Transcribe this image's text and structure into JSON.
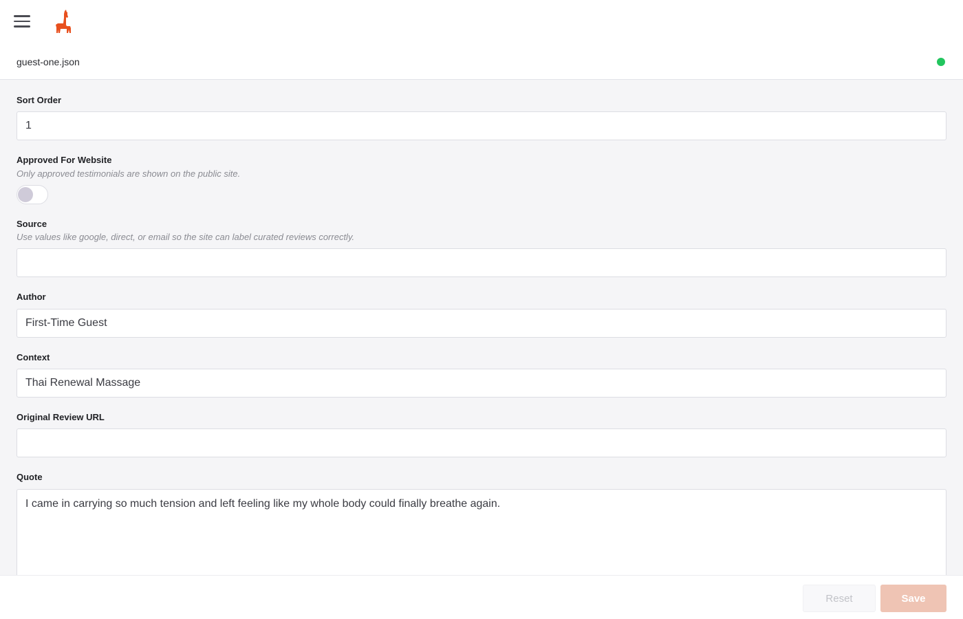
{
  "header": {
    "filename": "guest-one.json",
    "status_color": "#22c55e",
    "logo_color": "#e8501e",
    "menu_icon": "hamburger-menu-icon",
    "logo_icon": "llama-logo-icon"
  },
  "fields": {
    "sort_order": {
      "label": "Sort Order",
      "value": "1"
    },
    "approved": {
      "label": "Approved For Website",
      "help": "Only approved testimonials are shown on the public site.",
      "checked": false
    },
    "source": {
      "label": "Source",
      "help": "Use values like google, direct, or email so the site can label curated reviews correctly.",
      "value": ""
    },
    "author": {
      "label": "Author",
      "value": "First-Time Guest"
    },
    "context": {
      "label": "Context",
      "value": "Thai Renewal Massage"
    },
    "review_url": {
      "label": "Original Review URL",
      "value": ""
    },
    "quote": {
      "label": "Quote",
      "value": "I came in carrying so much tension and left feeling like my whole body could finally breathe again."
    }
  },
  "footer": {
    "reset_label": "Reset",
    "save_label": "Save",
    "save_color": "#efc4b4"
  }
}
